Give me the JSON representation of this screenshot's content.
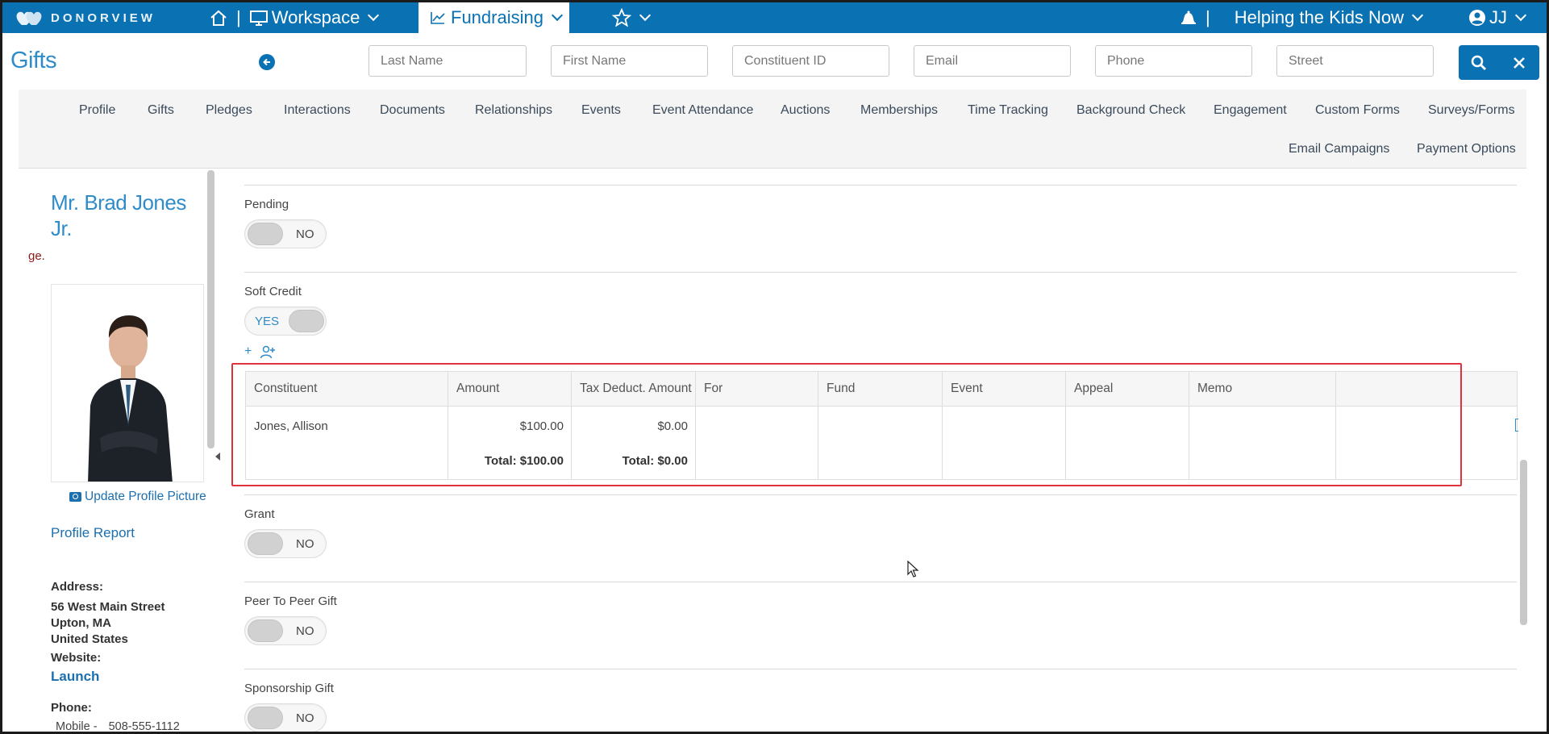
{
  "app": {
    "brand": "DONORVIEW",
    "nav": {
      "home_icon": "home-icon",
      "separator": "|",
      "workspace": "Workspace",
      "fundraising": "Fundraising",
      "favorites_icon": "star-icon",
      "notification_icon": "bell-icon",
      "organization": "Helping the Kids Now",
      "user": "JJ"
    },
    "accent": "#0a71b3"
  },
  "header": {
    "title": "Gifts",
    "search": {
      "last_name": "Last Name",
      "first_name": "First Name",
      "constituent_id": "Constituent ID",
      "email": "Email",
      "phone": "Phone",
      "street": "Street"
    }
  },
  "profile_nav": {
    "row1": [
      "Profile",
      "Gifts",
      "Pledges",
      "Interactions",
      "Documents",
      "Relationships",
      "Events",
      "Event Attendance",
      "Auctions",
      "Memberships",
      "Time Tracking",
      "Background Check",
      "Engagement",
      "Custom Forms",
      "Surveys/Forms"
    ],
    "row2": [
      "Email Campaigns",
      "Payment Options"
    ]
  },
  "sidebar": {
    "name": "Mr. Brad Jones Jr.",
    "truncated_text": "ge.",
    "update_picture": "Update Profile Picture",
    "profile_report": "Profile Report",
    "address_label": "Address:",
    "address_line1": "56 West Main Street",
    "address_line2": "Upton, MA",
    "address_line3": "United States",
    "website_label": "Website:",
    "website_link": "Launch",
    "phone_label": "Phone:",
    "phone_type": "Mobile -",
    "phone_number": "508-555-1112"
  },
  "form": {
    "pending": {
      "label": "Pending",
      "value": "NO"
    },
    "soft_credit": {
      "label": "Soft Credit",
      "value": "YES"
    },
    "soft_credit_add": "+",
    "grant": {
      "label": "Grant",
      "value": "NO"
    },
    "peer_to_peer": {
      "label": "Peer To Peer Gift",
      "value": "NO"
    },
    "sponsorship": {
      "label": "Sponsorship Gift",
      "value": "NO"
    }
  },
  "soft_credit_table": {
    "columns": [
      "Constituent",
      "Amount",
      "Tax Deduct. Amount",
      "For",
      "Fund",
      "Event",
      "Appeal",
      "Memo"
    ],
    "rows": [
      {
        "constituent": "Jones, Allison",
        "amount": "$100.00",
        "tax_deduct": "$0.00",
        "for": "",
        "fund": "",
        "event": "",
        "appeal": "",
        "memo": ""
      }
    ],
    "total_amount": "Total: $100.00",
    "total_tax": "Total: $0.00"
  }
}
